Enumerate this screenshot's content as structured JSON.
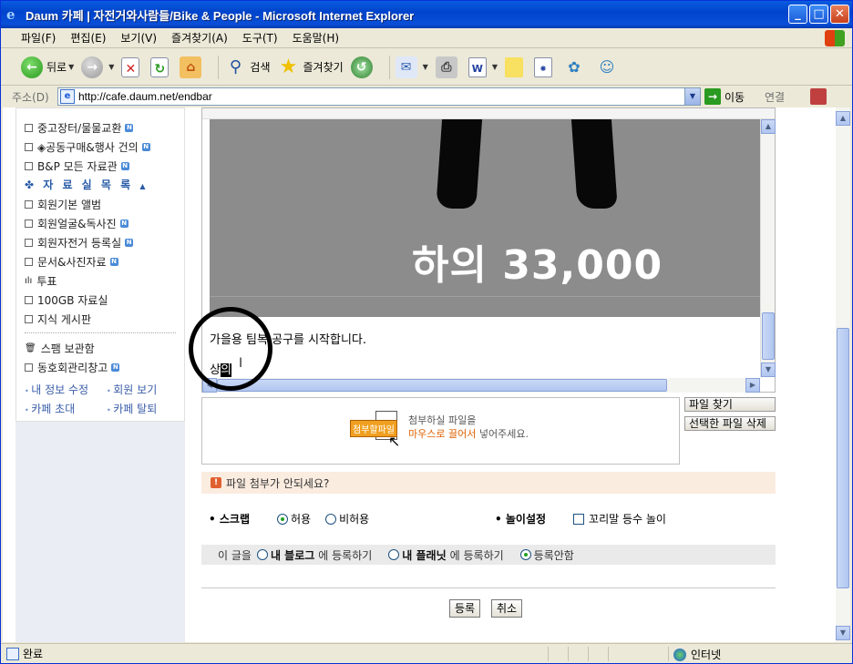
{
  "window": {
    "title": "Daum 카페 | 자전거와사람들/Bike & People - Microsoft Internet Explorer"
  },
  "menu": [
    "파일(F)",
    "편집(E)",
    "보기(V)",
    "즐겨찾기(A)",
    "도구(T)",
    "도움말(H)"
  ],
  "toolbar": {
    "back_label": "뒤로",
    "search_label": "검색",
    "favorites_label": "즐겨찾기"
  },
  "address": {
    "label": "주소(D)",
    "url": "http://cafe.daum.net/endbar",
    "go_label": "이동",
    "links_label": "연결"
  },
  "sidebar": {
    "items_top": [
      {
        "label": "중고장터/물물교환",
        "new": true
      },
      {
        "label": "◈공동구매&행사 건의",
        "new": true
      },
      {
        "label": "B&P 모든 자료관",
        "new": true
      }
    ],
    "section_title": "자 료 실 목 록",
    "items_archive": [
      {
        "label": "회원기본 앨범",
        "new": false
      },
      {
        "label": "회원얼굴&독사진",
        "new": true
      },
      {
        "label": "회원자전거 등록실",
        "new": true
      },
      {
        "label": "문서&사진자료",
        "new": true
      },
      {
        "label": "투표",
        "new": false
      },
      {
        "label": "100GB 자료실",
        "new": false
      },
      {
        "label": "지식 게시판",
        "new": false
      }
    ],
    "items_bottom": [
      {
        "label": "스팸 보관함",
        "new": false
      },
      {
        "label": "동호회관리창고",
        "new": true
      }
    ],
    "links": [
      "내 정보 수정",
      "회원 보기",
      "카페 초대",
      "카페 탈퇴"
    ]
  },
  "editor": {
    "image_text": "하의  33,000",
    "line1": "가을용 팀복 공구를 시작합니다.",
    "line2_prefix": "상",
    "line2_highlight": "의"
  },
  "attach": {
    "badge": "첨부할파일",
    "hint_line1": "첨부하실 파일을",
    "hint_line2_orange": "마우스로 끌어서",
    "hint_line2_rest": " 넣어주세요.",
    "find_button": "파일 찾기",
    "delete_button": "선택한 파일 삭제"
  },
  "notice": "파일 첨부가 안되세요?",
  "scrap": {
    "label": "스크랩",
    "allow": "허용",
    "deny": "비허용",
    "selected": "허용"
  },
  "play": {
    "label": "놀이설정",
    "option": "꼬리말 등수 놀이"
  },
  "register": {
    "prefix": "이 글을",
    "blog": "내 블로그",
    "blog_suffix": "에 등록하기",
    "planet": "내 플래닛",
    "planet_suffix": "에 등록하기",
    "none": "등록안함",
    "selected": "등록안함"
  },
  "buttons": {
    "submit": "등록",
    "cancel": "취소"
  },
  "status": {
    "text": "완료",
    "zone": "인터넷"
  }
}
